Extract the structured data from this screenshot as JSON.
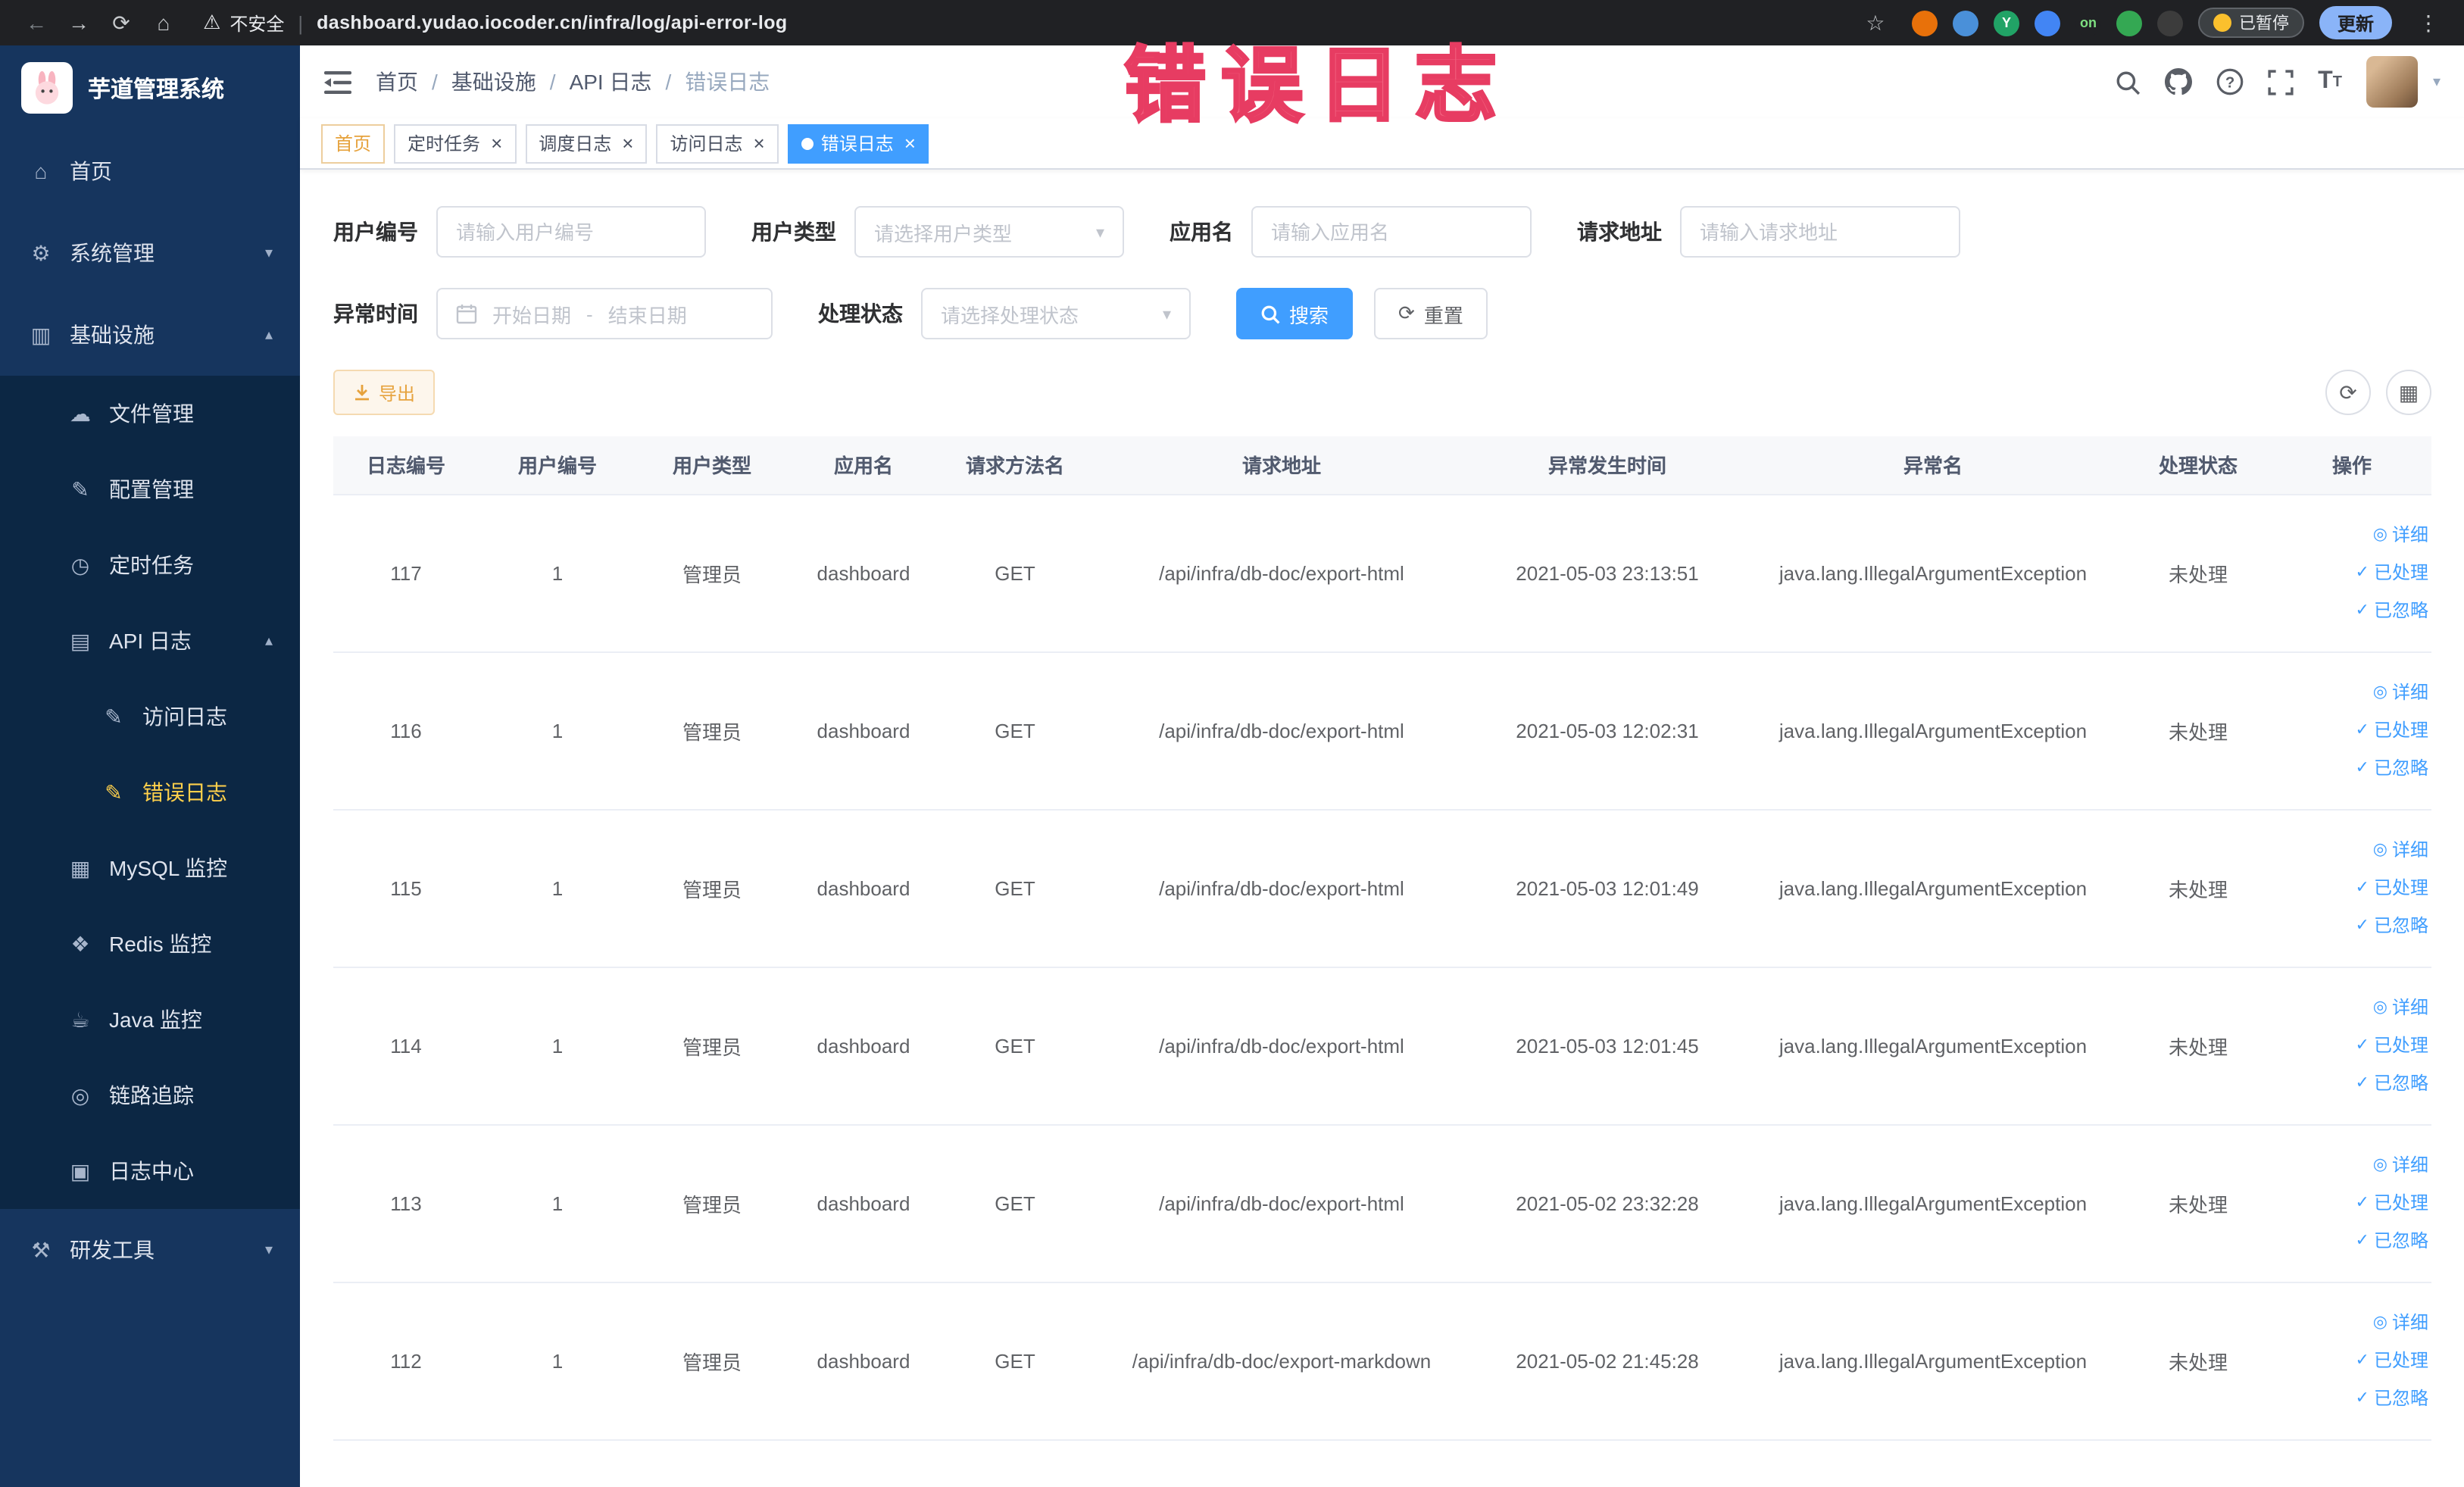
{
  "colors": {
    "accent": "#409eff",
    "active_menu": "#ffd04b",
    "warning": "#e6a23c",
    "overlay_red": "#ee3e63",
    "sidebar_bg": "#16355e",
    "submenu_bg": "#0c2744"
  },
  "overlay": {
    "text": "错误日志"
  },
  "browser": {
    "security_warning": "不安全",
    "url": "dashboard.yudao.iocoder.cn/infra/log/api-error-log",
    "paused_badge": "已暂停",
    "update_button": "更新",
    "extensions": [
      {
        "name": "extension-orange-icon",
        "color": "#e8710a"
      },
      {
        "name": "extension-blue-icon",
        "color": "#4a90d9"
      },
      {
        "name": "extension-avatar-icon",
        "color": "#21a366",
        "text": "Y"
      },
      {
        "name": "extension-grid-icon",
        "color": "#4285f4"
      },
      {
        "name": "extension-on-badge",
        "color": "#202124",
        "text": "on",
        "text_color": "#7ee081"
      },
      {
        "name": "extension-green-icon",
        "color": "#34a853"
      },
      {
        "name": "extension-dark-icon",
        "color": "#3c3c3c"
      }
    ]
  },
  "sidebar": {
    "app_title": "芋道管理系统",
    "menu": [
      {
        "key": "home",
        "label": "首页",
        "icon": "home-icon",
        "type": "top"
      },
      {
        "key": "system-management",
        "label": "系统管理",
        "icon": "gear-icon",
        "type": "top",
        "chevron": "down"
      },
      {
        "key": "infrastructure",
        "label": "基础设施",
        "icon": "infra-icon",
        "type": "top",
        "chevron": "up"
      },
      {
        "key": "file-management",
        "label": "文件管理",
        "icon": "file-icon",
        "type": "sub1"
      },
      {
        "key": "config-management",
        "label": "配置管理",
        "icon": "config-icon",
        "type": "sub1"
      },
      {
        "key": "scheduled-jobs",
        "label": "定时任务",
        "icon": "timer-icon",
        "type": "sub1"
      },
      {
        "key": "api-log",
        "label": "API 日志",
        "icon": "api-log-icon",
        "type": "sub1",
        "chevron": "up"
      },
      {
        "key": "access-log",
        "label": "访问日志",
        "icon": "access-log-icon",
        "type": "sub2"
      },
      {
        "key": "error-log",
        "label": "错误日志",
        "icon": "error-log-icon",
        "type": "sub2",
        "active": true
      },
      {
        "key": "mysql-monitor",
        "label": "MySQL 监控",
        "icon": "mysql-icon",
        "type": "sub1"
      },
      {
        "key": "redis-monitor",
        "label": "Redis 监控",
        "icon": "redis-icon",
        "type": "sub1"
      },
      {
        "key": "java-monitor",
        "label": "Java 监控",
        "icon": "java-icon",
        "type": "sub1"
      },
      {
        "key": "tracing",
        "label": "链路追踪",
        "icon": "trace-icon",
        "type": "sub1"
      },
      {
        "key": "log-center",
        "label": "日志中心",
        "icon": "log-center-icon",
        "type": "sub1"
      },
      {
        "key": "dev-tools",
        "label": "研发工具",
        "icon": "tools-icon",
        "type": "top",
        "chevron": "down"
      }
    ]
  },
  "breadcrumb": {
    "items": [
      "首页",
      "基础设施",
      "API 日志",
      "错误日志"
    ]
  },
  "tabs": [
    {
      "key": "home",
      "label": "首页",
      "closable": false,
      "affix": true
    },
    {
      "key": "scheduled-jobs",
      "label": "定时任务",
      "closable": true
    },
    {
      "key": "job-log",
      "label": "调度日志",
      "closable": true
    },
    {
      "key": "access-log",
      "label": "访问日志",
      "closable": true
    },
    {
      "key": "error-log",
      "label": "错误日志",
      "closable": true,
      "active": true
    }
  ],
  "filters": {
    "user_id": {
      "label": "用户编号",
      "placeholder": "请输入用户编号"
    },
    "user_type": {
      "label": "用户类型",
      "placeholder": "请选择用户类型"
    },
    "app_name": {
      "label": "应用名",
      "placeholder": "请输入应用名"
    },
    "request_url": {
      "label": "请求地址",
      "placeholder": "请输入请求地址"
    },
    "exception_time": {
      "label": "异常时间",
      "start_placeholder": "开始日期",
      "separator": "-",
      "end_placeholder": "结束日期"
    },
    "process_status": {
      "label": "处理状态",
      "placeholder": "请选择处理状态"
    },
    "search_button": "搜索",
    "reset_button": "重置"
  },
  "toolbar": {
    "export_label": "导出"
  },
  "table": {
    "columns": [
      "日志编号",
      "用户编号",
      "用户类型",
      "应用名",
      "请求方法名",
      "请求地址",
      "异常发生时间",
      "异常名",
      "处理状态",
      "操作"
    ],
    "actions": [
      {
        "key": "detail",
        "label": "详细",
        "icon": "eye-icon"
      },
      {
        "key": "mark-processed",
        "label": "已处理",
        "icon": "check-icon"
      },
      {
        "key": "mark-ignored",
        "label": "已忽略",
        "icon": "check-icon"
      }
    ],
    "rows": [
      {
        "id": "117",
        "user_id": "1",
        "user_type": "管理员",
        "app": "dashboard",
        "method": "GET",
        "url": "/api/infra/db-doc/export-html",
        "time": "2021-05-03 23:13:51",
        "exception": "java.lang.IllegalArgumentException",
        "status": "未处理"
      },
      {
        "id": "116",
        "user_id": "1",
        "user_type": "管理员",
        "app": "dashboard",
        "method": "GET",
        "url": "/api/infra/db-doc/export-html",
        "time": "2021-05-03 12:02:31",
        "exception": "java.lang.IllegalArgumentException",
        "status": "未处理"
      },
      {
        "id": "115",
        "user_id": "1",
        "user_type": "管理员",
        "app": "dashboard",
        "method": "GET",
        "url": "/api/infra/db-doc/export-html",
        "time": "2021-05-03 12:01:49",
        "exception": "java.lang.IllegalArgumentException",
        "status": "未处理"
      },
      {
        "id": "114",
        "user_id": "1",
        "user_type": "管理员",
        "app": "dashboard",
        "method": "GET",
        "url": "/api/infra/db-doc/export-html",
        "time": "2021-05-03 12:01:45",
        "exception": "java.lang.IllegalArgumentException",
        "status": "未处理"
      },
      {
        "id": "113",
        "user_id": "1",
        "user_type": "管理员",
        "app": "dashboard",
        "method": "GET",
        "url": "/api/infra/db-doc/export-html",
        "time": "2021-05-02 23:32:28",
        "exception": "java.lang.IllegalArgumentException",
        "status": "未处理"
      },
      {
        "id": "112",
        "user_id": "1",
        "user_type": "管理员",
        "app": "dashboard",
        "method": "GET",
        "url": "/api/infra/db-doc/export-markdown",
        "time": "2021-05-02 21:45:28",
        "exception": "java.lang.IllegalArgumentException",
        "status": "未处理"
      }
    ]
  }
}
